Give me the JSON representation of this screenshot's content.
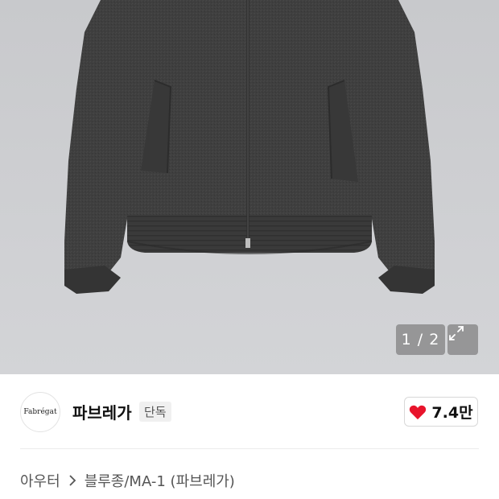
{
  "gallery": {
    "current_page": "1",
    "total_pages": "2",
    "page_text": "1 / 2",
    "image_alt": "charcoal wool zip-up blouson jacket",
    "expand_icon": "expand-icon"
  },
  "brand": {
    "logo_text": "Fabrégat",
    "name": "파브레가",
    "badge": "단독"
  },
  "likes": {
    "count": "7.4만",
    "icon": "heart-icon",
    "color": "#e8142c"
  },
  "breadcrumb": {
    "category": "아우터",
    "separator_icon": "chevron-right-icon",
    "subcategory": "블루종/MA-1 (파브레가)"
  }
}
